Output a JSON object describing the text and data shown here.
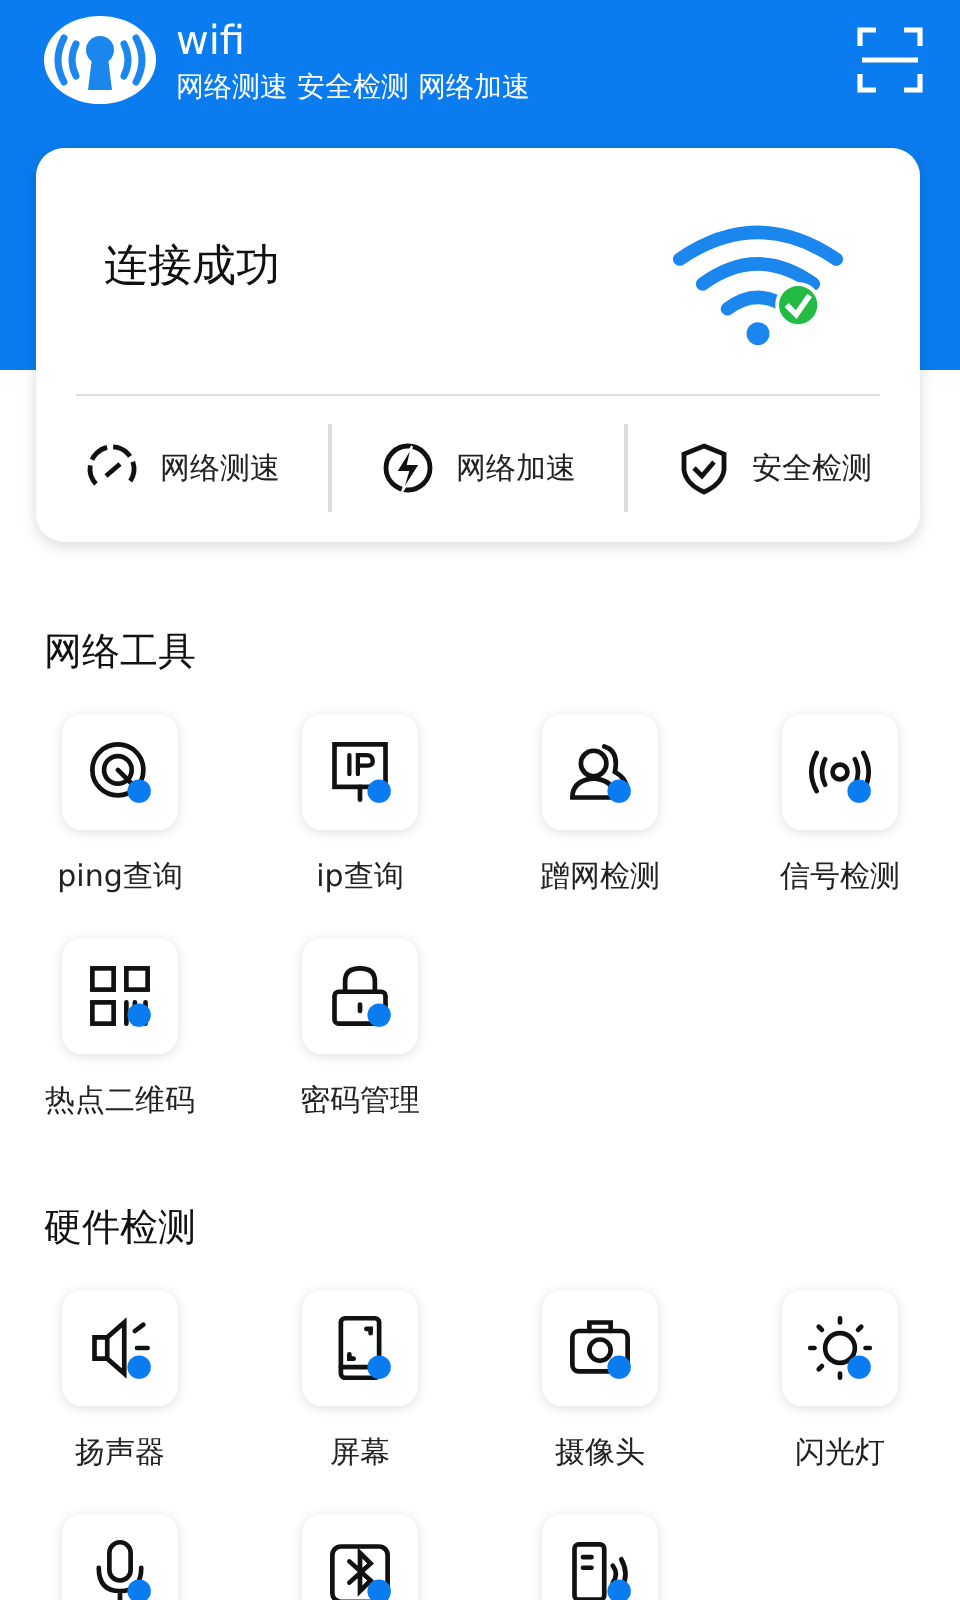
{
  "header": {
    "title": "wifi",
    "subtitle": "网络测速 安全检测 网络加速"
  },
  "status_card": {
    "status": "连接成功",
    "connected": true,
    "actions": [
      {
        "label": "网络测速",
        "kind": "speed"
      },
      {
        "label": "网络加速",
        "kind": "boost"
      },
      {
        "label": "安全检测",
        "kind": "shield"
      }
    ]
  },
  "sections": [
    {
      "title": "网络工具",
      "items": [
        {
          "label": "ping查询",
          "kind": "ping"
        },
        {
          "label": "ip查询",
          "kind": "ip"
        },
        {
          "label": "蹭网检测",
          "kind": "users"
        },
        {
          "label": "信号检测",
          "kind": "signal"
        },
        {
          "label": "热点二维码",
          "kind": "qr"
        },
        {
          "label": "密码管理",
          "kind": "lock"
        }
      ]
    },
    {
      "title": "硬件检测",
      "items": [
        {
          "label": "扬声器",
          "kind": "speaker"
        },
        {
          "label": "屏幕",
          "kind": "screen"
        },
        {
          "label": "摄像头",
          "kind": "camera"
        },
        {
          "label": "闪光灯",
          "kind": "flash"
        },
        {
          "kind": "mic"
        },
        {
          "kind": "bluetooth"
        },
        {
          "kind": "nfc"
        }
      ]
    }
  ]
}
